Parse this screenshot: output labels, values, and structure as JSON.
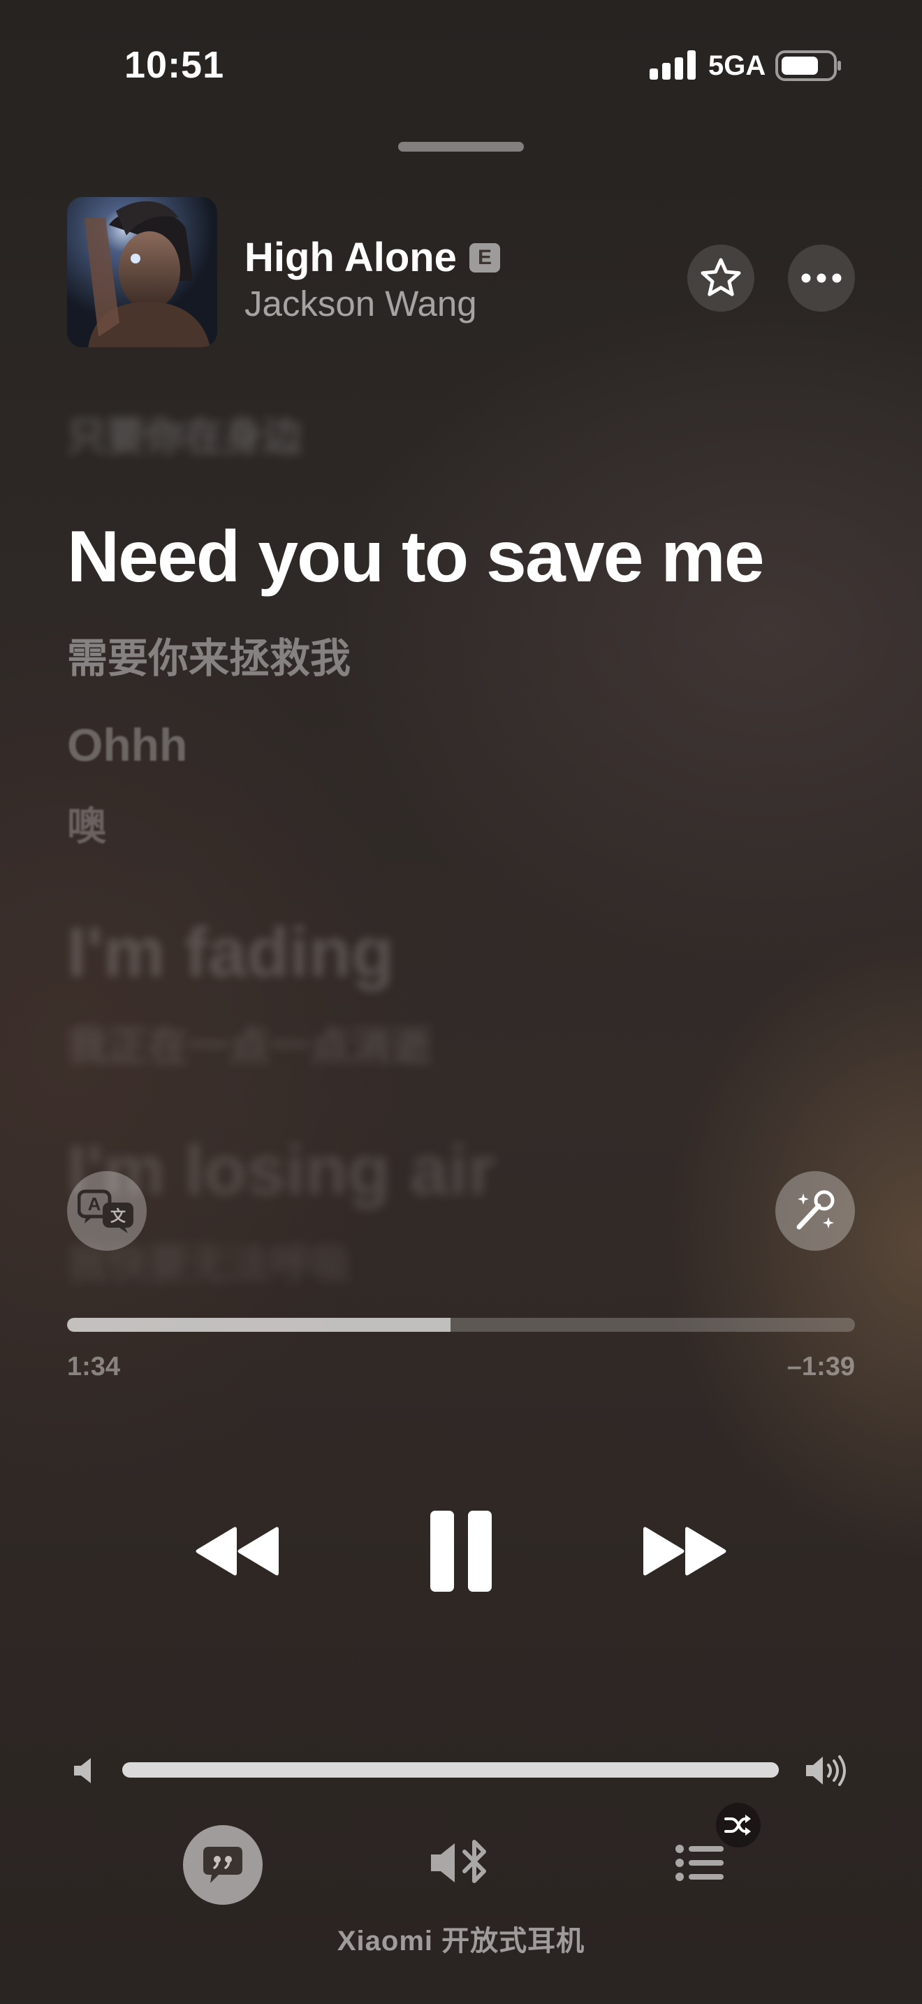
{
  "status_bar": {
    "time": "10:51",
    "network": "5GA",
    "icons": [
      "signal-icon",
      "battery-icon"
    ]
  },
  "now_playing": {
    "title": "High Alone",
    "explicit_badge": "E",
    "artist": "Jackson Wang",
    "buttons": {
      "favorite": "star-icon",
      "more": "ellipsis-icon"
    }
  },
  "lyrics": {
    "previous_translation": "只要你在身边",
    "active_line": "Need you to save me",
    "active_translation": "需要你来拯救我",
    "next_lines": [
      {
        "text": "Ohhh",
        "translation": "噢"
      },
      {
        "text": "I'm fading",
        "translation": "我正在一点一点消逝"
      },
      {
        "text": "I'm losing air",
        "translation": "我快要无法呼吸"
      }
    ]
  },
  "controls": {
    "translate_button": "translate-icon",
    "sing_button": "microphone-sparkle-icon",
    "elapsed": "1:34",
    "remaining": "–1:39",
    "progress_fraction": 0.487,
    "volume_fraction": 1.0,
    "transport": [
      "rewind-icon",
      "pause-icon",
      "fast-forward-icon"
    ]
  },
  "bottom_bar": {
    "lyrics_icon": "quote-bubble-icon",
    "airplay_icon": "speaker-bluetooth-icon",
    "queue_icon": "list-icon",
    "shuffle_badge": "shuffle-icon",
    "output_device": "Xiaomi 开放式耳机"
  },
  "colors": {
    "background": "#2e2826",
    "active_lyric": "#ffffff",
    "accent_dim": "#8d8583"
  }
}
